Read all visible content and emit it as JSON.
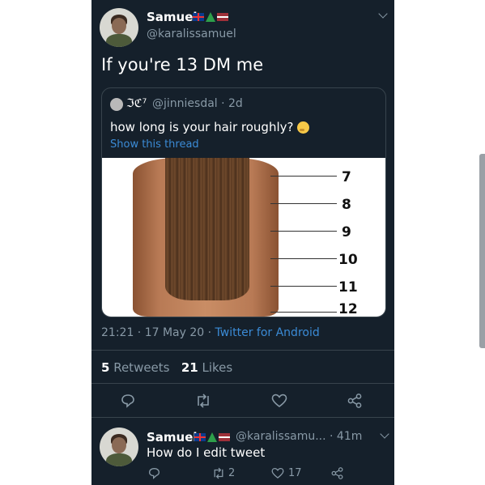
{
  "tweet": {
    "author_name": "Samuel",
    "author_handle": "@karalissamuel",
    "text": "If you're 13 DM me",
    "quote": {
      "author_name": "ℑℭ⁷",
      "author_handle": "@jinniesdal · 2d",
      "text": "how long is your hair roughly?",
      "show_thread": "Show this thread",
      "image_labels": [
        "7",
        "8",
        "9",
        "10",
        "11",
        "12"
      ]
    },
    "timestamp": "21:21 · 17 May 20 · ",
    "source_app": "Twitter for Android",
    "retweets_count": "5",
    "retweets_label": " Retweets",
    "likes_count": "21",
    "likes_label": " Likes"
  },
  "reply": {
    "author_name": "Samuel",
    "author_handle": "@karalissamu... · 41m",
    "text": "How do I edit tweet",
    "retweet_count": "2",
    "like_count": "17"
  },
  "icons": {
    "flags": [
      "uk-flag-icon",
      "christmas-tree-icon",
      "latvia-flag-icon"
    ],
    "actions": [
      "reply-icon",
      "retweet-icon",
      "like-icon",
      "share-icon"
    ]
  },
  "colors": {
    "background": "#15202b",
    "link": "#3b8bd6",
    "secondary_text": "#8899a6",
    "divider": "#38444d"
  }
}
